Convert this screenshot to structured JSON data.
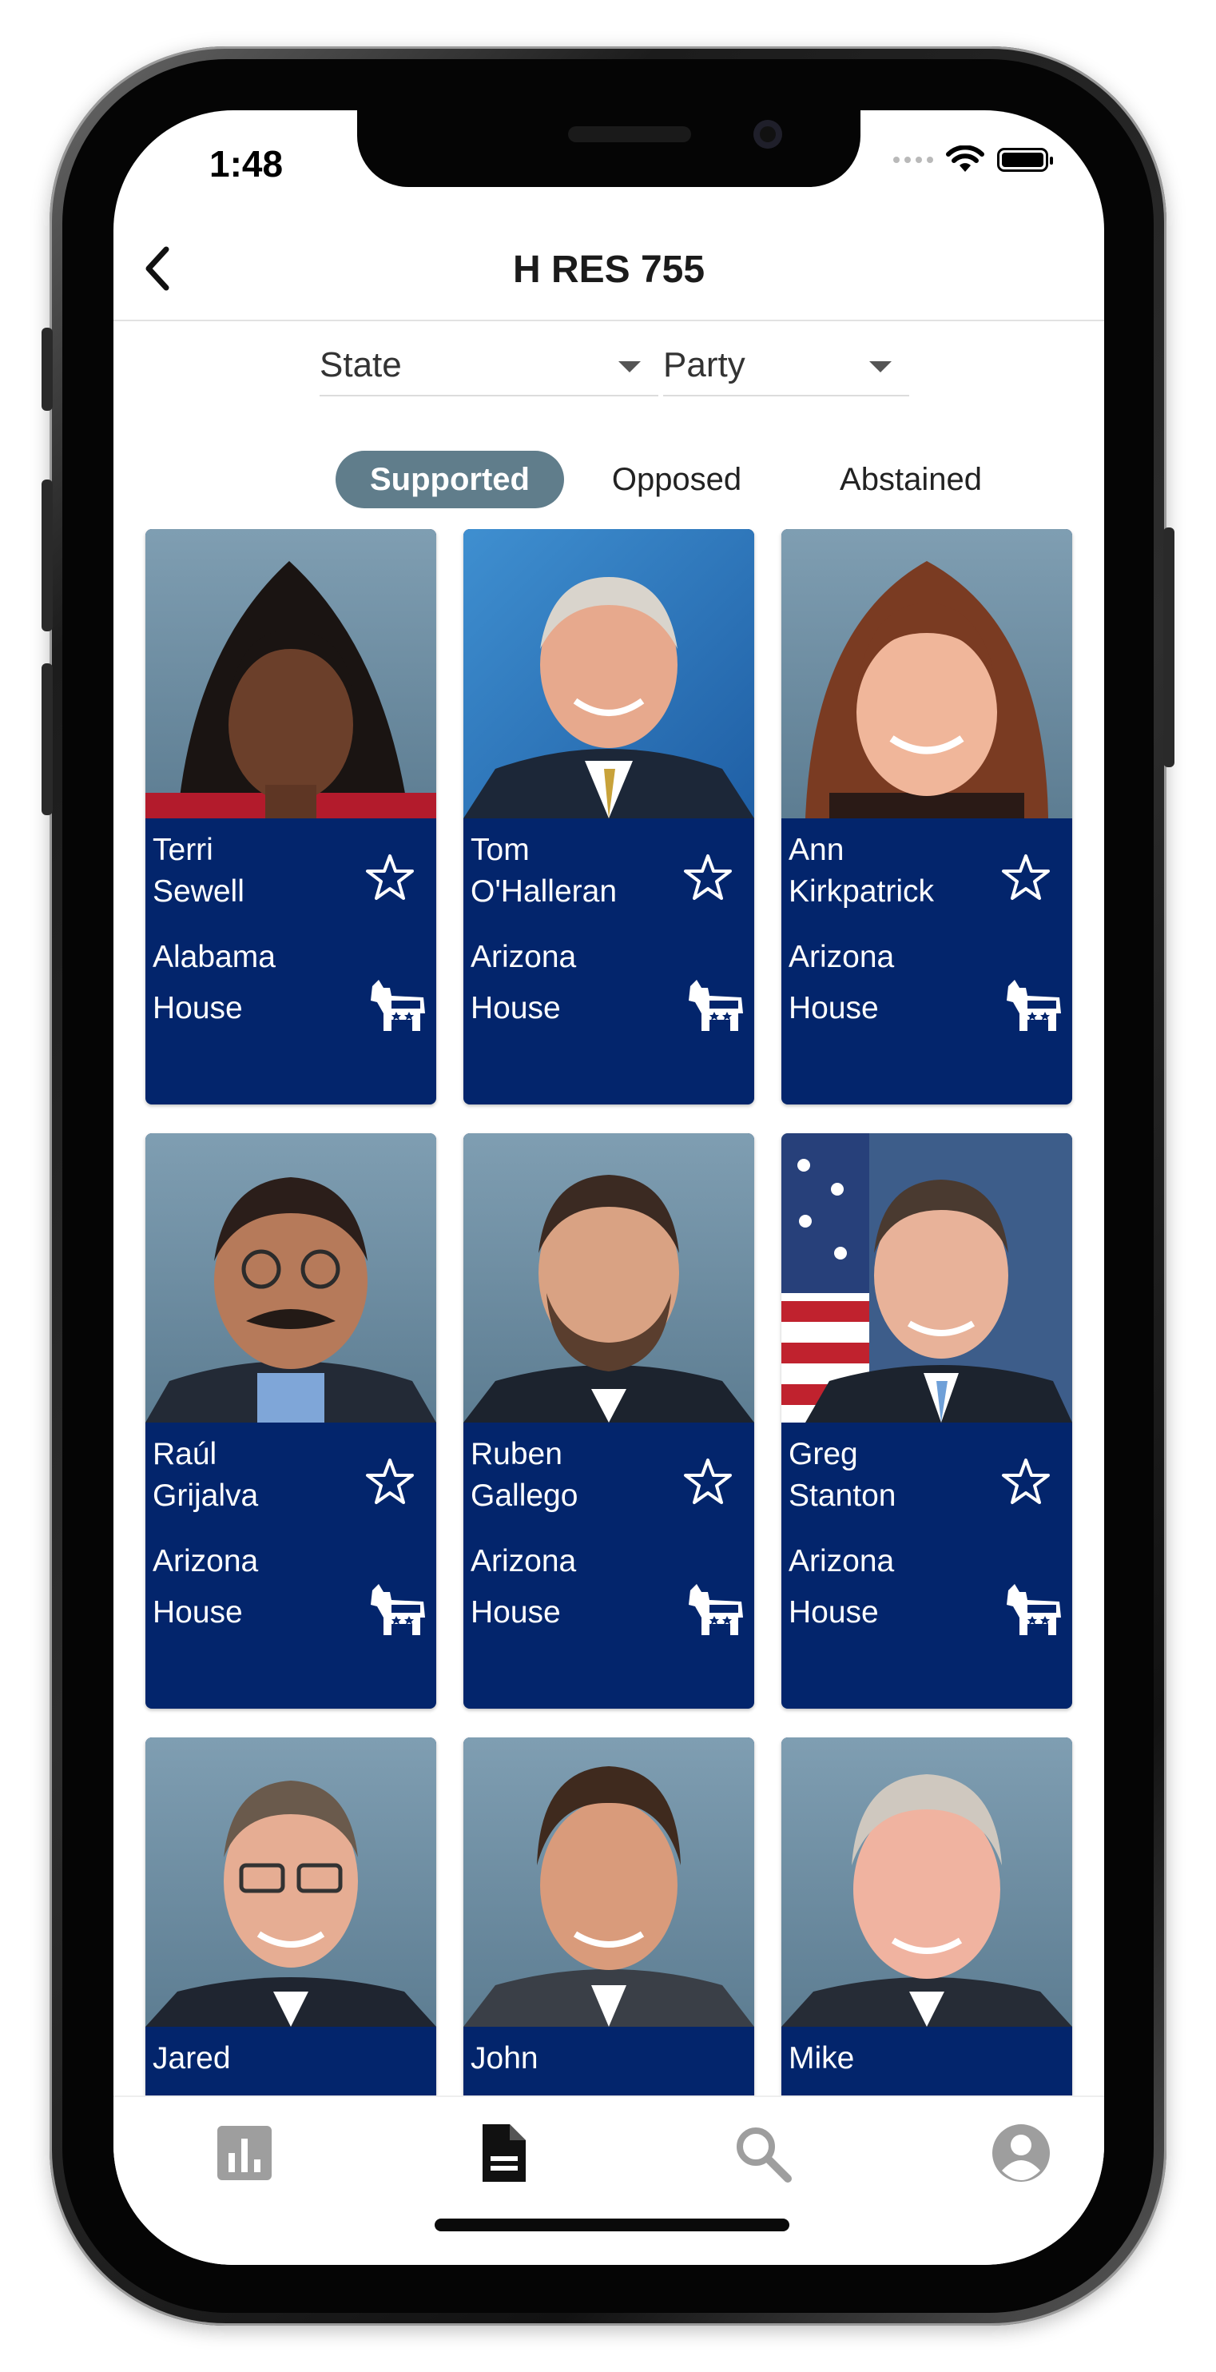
{
  "status_bar": {
    "time": "1:48"
  },
  "header": {
    "title": "H RES 755"
  },
  "filters": {
    "state_label": "State",
    "party_label": "Party"
  },
  "tabs": [
    {
      "label": "Supported",
      "active": true
    },
    {
      "label": "Opposed",
      "active": false
    },
    {
      "label": "Abstained",
      "active": false
    }
  ],
  "representatives": [
    {
      "first": "Terri",
      "last": "Sewell",
      "state": "Alabama",
      "chamber": "House",
      "party_icon": "democrat-donkey-icon",
      "favorite_icon": "star-outline-icon"
    },
    {
      "first": "Tom",
      "last": "O'Halleran",
      "state": "Arizona",
      "chamber": "House",
      "party_icon": "democrat-donkey-icon",
      "favorite_icon": "star-outline-icon"
    },
    {
      "first": "Ann",
      "last": "Kirkpatrick",
      "state": "Arizona",
      "chamber": "House",
      "party_icon": "democrat-donkey-icon",
      "favorite_icon": "star-outline-icon"
    },
    {
      "first": "Raúl",
      "last": "Grijalva",
      "state": "Arizona",
      "chamber": "House",
      "party_icon": "democrat-donkey-icon",
      "favorite_icon": "star-outline-icon"
    },
    {
      "first": "Ruben",
      "last": "Gallego",
      "state": "Arizona",
      "chamber": "House",
      "party_icon": "democrat-donkey-icon",
      "favorite_icon": "star-outline-icon"
    },
    {
      "first": "Greg",
      "last": "Stanton",
      "state": "Arizona",
      "chamber": "House",
      "party_icon": "democrat-donkey-icon",
      "favorite_icon": "star-outline-icon"
    },
    {
      "first": "Jared",
      "last": "",
      "state": "",
      "chamber": "",
      "party_icon": "democrat-donkey-icon",
      "favorite_icon": "star-outline-icon"
    },
    {
      "first": "John",
      "last": "",
      "state": "",
      "chamber": "",
      "party_icon": "democrat-donkey-icon",
      "favorite_icon": "star-outline-icon"
    },
    {
      "first": "Mike",
      "last": "",
      "state": "",
      "chamber": "",
      "party_icon": "democrat-donkey-icon",
      "favorite_icon": "star-outline-icon"
    }
  ],
  "bottom_nav": [
    {
      "icon": "bar-chart-icon",
      "active": false
    },
    {
      "icon": "document-icon",
      "active": true
    },
    {
      "icon": "search-icon",
      "active": false
    },
    {
      "icon": "account-icon",
      "active": false
    }
  ],
  "colors": {
    "card_background": "#03256c",
    "tab_active": "#607d8b",
    "nav_active": "#111111",
    "nav_inactive": "#9e9e9e"
  }
}
